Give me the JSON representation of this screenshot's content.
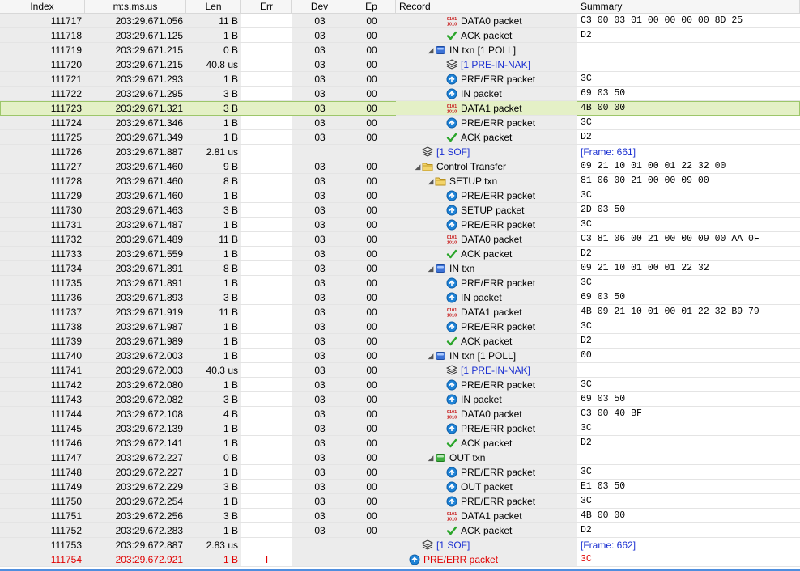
{
  "columns": {
    "index": "Index",
    "time": "m:s.ms.us",
    "len": "Len",
    "err": "Err",
    "dev": "Dev",
    "ep": "Ep",
    "record": "Record",
    "summary": "Summary"
  },
  "colors": {
    "selected_row": "#e4f0c6",
    "error_text": "#e00000",
    "link_text": "#1a2fd1",
    "pid_icon": "#1e82d6",
    "ack_icon": "#2aa52a",
    "data_icon": "#c81e1e"
  },
  "rows": [
    {
      "index": "111717",
      "time": "203:29.671.056",
      "len": "11 B",
      "err": "",
      "dev": "03",
      "ep": "00",
      "record": "DATA0 packet",
      "summary": "C3 00 03 01 00 00 00 00 8D 25",
      "icon": "data-icon",
      "depth": 3,
      "expander": ""
    },
    {
      "index": "111718",
      "time": "203:29.671.125",
      "len": "1 B",
      "err": "",
      "dev": "03",
      "ep": "00",
      "record": "ACK packet",
      "summary": "D2",
      "icon": "ack-icon",
      "depth": 3,
      "expander": ""
    },
    {
      "index": "111719",
      "time": "203:29.671.215",
      "len": "0 B",
      "err": "",
      "dev": "03",
      "ep": "00",
      "record": "IN txn  [1 POLL]",
      "summary": "",
      "icon": "in-txn-icon",
      "depth": 2,
      "expander": "◢"
    },
    {
      "index": "111720",
      "time": "203:29.671.215",
      "len": "40.8 us",
      "err": "",
      "dev": "03",
      "ep": "00",
      "record": "[1 PRE-IN-NAK]",
      "summary": "",
      "icon": "stack-icon",
      "depth": 3,
      "expander": "",
      "link": true
    },
    {
      "index": "111721",
      "time": "203:29.671.293",
      "len": "1 B",
      "err": "",
      "dev": "03",
      "ep": "00",
      "record": "PRE/ERR packet",
      "summary": "3C",
      "icon": "pid-icon",
      "depth": 3,
      "expander": ""
    },
    {
      "index": "111722",
      "time": "203:29.671.295",
      "len": "3 B",
      "err": "",
      "dev": "03",
      "ep": "00",
      "record": "IN packet",
      "summary": "69 03 50",
      "icon": "pid-icon",
      "depth": 3,
      "expander": ""
    },
    {
      "index": "111723",
      "time": "203:29.671.321",
      "len": "3 B",
      "err": "",
      "dev": "03",
      "ep": "00",
      "record": "DATA1 packet",
      "summary": "4B 00 00",
      "icon": "data-icon",
      "depth": 3,
      "expander": "",
      "selected": true
    },
    {
      "index": "111724",
      "time": "203:29.671.346",
      "len": "1 B",
      "err": "",
      "dev": "03",
      "ep": "00",
      "record": "PRE/ERR packet",
      "summary": "3C",
      "icon": "pid-icon",
      "depth": 3,
      "expander": ""
    },
    {
      "index": "111725",
      "time": "203:29.671.349",
      "len": "1 B",
      "err": "",
      "dev": "03",
      "ep": "00",
      "record": "ACK packet",
      "summary": "D2",
      "icon": "ack-icon",
      "depth": 3,
      "expander": ""
    },
    {
      "index": "111726",
      "time": "203:29.671.887",
      "len": "2.81 us",
      "err": "",
      "dev": "",
      "ep": "",
      "record": "[1 SOF]",
      "summary": "[Frame: 661]",
      "icon": "stack-icon",
      "depth": 1,
      "expander": "",
      "link": true,
      "sumlink": true
    },
    {
      "index": "111727",
      "time": "203:29.671.460",
      "len": "9 B",
      "err": "",
      "dev": "03",
      "ep": "00",
      "record": "Control Transfer",
      "summary": "09 21 10 01 00 01 22 32 00",
      "icon": "folder-icon",
      "depth": 1,
      "expander": "◢"
    },
    {
      "index": "111728",
      "time": "203:29.671.460",
      "len": "8 B",
      "err": "",
      "dev": "03",
      "ep": "00",
      "record": "SETUP txn",
      "summary": "81 06 00 21 00 00 09 00",
      "icon": "folder-icon",
      "depth": 2,
      "expander": "◢"
    },
    {
      "index": "111729",
      "time": "203:29.671.460",
      "len": "1 B",
      "err": "",
      "dev": "03",
      "ep": "00",
      "record": "PRE/ERR packet",
      "summary": "3C",
      "icon": "pid-icon",
      "depth": 3,
      "expander": ""
    },
    {
      "index": "111730",
      "time": "203:29.671.463",
      "len": "3 B",
      "err": "",
      "dev": "03",
      "ep": "00",
      "record": "SETUP packet",
      "summary": "2D 03 50",
      "icon": "pid-icon",
      "depth": 3,
      "expander": ""
    },
    {
      "index": "111731",
      "time": "203:29.671.487",
      "len": "1 B",
      "err": "",
      "dev": "03",
      "ep": "00",
      "record": "PRE/ERR packet",
      "summary": "3C",
      "icon": "pid-icon",
      "depth": 3,
      "expander": ""
    },
    {
      "index": "111732",
      "time": "203:29.671.489",
      "len": "11 B",
      "err": "",
      "dev": "03",
      "ep": "00",
      "record": "DATA0 packet",
      "summary": "C3 81 06 00 21 00 00 09 00 AA 0F",
      "icon": "data-icon",
      "depth": 3,
      "expander": ""
    },
    {
      "index": "111733",
      "time": "203:29.671.559",
      "len": "1 B",
      "err": "",
      "dev": "03",
      "ep": "00",
      "record": "ACK packet",
      "summary": "D2",
      "icon": "ack-icon",
      "depth": 3,
      "expander": ""
    },
    {
      "index": "111734",
      "time": "203:29.671.891",
      "len": "8 B",
      "err": "",
      "dev": "03",
      "ep": "00",
      "record": "IN txn",
      "summary": "09 21 10 01 00 01 22 32",
      "icon": "in-txn-icon",
      "depth": 2,
      "expander": "◢"
    },
    {
      "index": "111735",
      "time": "203:29.671.891",
      "len": "1 B",
      "err": "",
      "dev": "03",
      "ep": "00",
      "record": "PRE/ERR packet",
      "summary": "3C",
      "icon": "pid-icon",
      "depth": 3,
      "expander": ""
    },
    {
      "index": "111736",
      "time": "203:29.671.893",
      "len": "3 B",
      "err": "",
      "dev": "03",
      "ep": "00",
      "record": "IN packet",
      "summary": "69 03 50",
      "icon": "pid-icon",
      "depth": 3,
      "expander": ""
    },
    {
      "index": "111737",
      "time": "203:29.671.919",
      "len": "11 B",
      "err": "",
      "dev": "03",
      "ep": "00",
      "record": "DATA1 packet",
      "summary": "4B 09 21 10 01 00 01 22 32 B9 79",
      "icon": "data-icon",
      "depth": 3,
      "expander": ""
    },
    {
      "index": "111738",
      "time": "203:29.671.987",
      "len": "1 B",
      "err": "",
      "dev": "03",
      "ep": "00",
      "record": "PRE/ERR packet",
      "summary": "3C",
      "icon": "pid-icon",
      "depth": 3,
      "expander": ""
    },
    {
      "index": "111739",
      "time": "203:29.671.989",
      "len": "1 B",
      "err": "",
      "dev": "03",
      "ep": "00",
      "record": "ACK packet",
      "summary": "D2",
      "icon": "ack-icon",
      "depth": 3,
      "expander": ""
    },
    {
      "index": "111740",
      "time": "203:29.672.003",
      "len": "1 B",
      "err": "",
      "dev": "03",
      "ep": "00",
      "record": "IN txn  [1 POLL]",
      "summary": "00",
      "icon": "in-txn-icon",
      "depth": 2,
      "expander": "◢"
    },
    {
      "index": "111741",
      "time": "203:29.672.003",
      "len": "40.3 us",
      "err": "",
      "dev": "03",
      "ep": "00",
      "record": "[1 PRE-IN-NAK]",
      "summary": "",
      "icon": "stack-icon",
      "depth": 3,
      "expander": "",
      "link": true
    },
    {
      "index": "111742",
      "time": "203:29.672.080",
      "len": "1 B",
      "err": "",
      "dev": "03",
      "ep": "00",
      "record": "PRE/ERR packet",
      "summary": "3C",
      "icon": "pid-icon",
      "depth": 3,
      "expander": ""
    },
    {
      "index": "111743",
      "time": "203:29.672.082",
      "len": "3 B",
      "err": "",
      "dev": "03",
      "ep": "00",
      "record": "IN packet",
      "summary": "69 03 50",
      "icon": "pid-icon",
      "depth": 3,
      "expander": ""
    },
    {
      "index": "111744",
      "time": "203:29.672.108",
      "len": "4 B",
      "err": "",
      "dev": "03",
      "ep": "00",
      "record": "DATA0 packet",
      "summary": "C3 00 40 BF",
      "icon": "data-icon",
      "depth": 3,
      "expander": ""
    },
    {
      "index": "111745",
      "time": "203:29.672.139",
      "len": "1 B",
      "err": "",
      "dev": "03",
      "ep": "00",
      "record": "PRE/ERR packet",
      "summary": "3C",
      "icon": "pid-icon",
      "depth": 3,
      "expander": ""
    },
    {
      "index": "111746",
      "time": "203:29.672.141",
      "len": "1 B",
      "err": "",
      "dev": "03",
      "ep": "00",
      "record": "ACK packet",
      "summary": "D2",
      "icon": "ack-icon",
      "depth": 3,
      "expander": ""
    },
    {
      "index": "111747",
      "time": "203:29.672.227",
      "len": "0 B",
      "err": "",
      "dev": "03",
      "ep": "00",
      "record": "OUT txn",
      "summary": "",
      "icon": "out-txn-icon",
      "depth": 2,
      "expander": "◢"
    },
    {
      "index": "111748",
      "time": "203:29.672.227",
      "len": "1 B",
      "err": "",
      "dev": "03",
      "ep": "00",
      "record": "PRE/ERR packet",
      "summary": "3C",
      "icon": "pid-icon",
      "depth": 3,
      "expander": ""
    },
    {
      "index": "111749",
      "time": "203:29.672.229",
      "len": "3 B",
      "err": "",
      "dev": "03",
      "ep": "00",
      "record": "OUT packet",
      "summary": "E1 03 50",
      "icon": "pid-icon",
      "depth": 3,
      "expander": ""
    },
    {
      "index": "111750",
      "time": "203:29.672.254",
      "len": "1 B",
      "err": "",
      "dev": "03",
      "ep": "00",
      "record": "PRE/ERR packet",
      "summary": "3C",
      "icon": "pid-icon",
      "depth": 3,
      "expander": ""
    },
    {
      "index": "111751",
      "time": "203:29.672.256",
      "len": "3 B",
      "err": "",
      "dev": "03",
      "ep": "00",
      "record": "DATA1 packet",
      "summary": "4B 00 00",
      "icon": "data-icon",
      "depth": 3,
      "expander": ""
    },
    {
      "index": "111752",
      "time": "203:29.672.283",
      "len": "1 B",
      "err": "",
      "dev": "03",
      "ep": "00",
      "record": "ACK packet",
      "summary": "D2",
      "icon": "ack-icon",
      "depth": 3,
      "expander": ""
    },
    {
      "index": "111753",
      "time": "203:29.672.887",
      "len": "2.83 us",
      "err": "",
      "dev": "",
      "ep": "",
      "record": "[1 SOF]",
      "summary": "[Frame: 662]",
      "icon": "stack-icon",
      "depth": 1,
      "expander": "",
      "link": true,
      "sumlink": true
    },
    {
      "index": "111754",
      "time": "203:29.672.921",
      "len": "1 B",
      "err": "I",
      "dev": "",
      "ep": "",
      "record": "PRE/ERR packet",
      "summary": "3C",
      "icon": "pid-icon",
      "depth": 0,
      "expander": "",
      "error": true
    }
  ]
}
